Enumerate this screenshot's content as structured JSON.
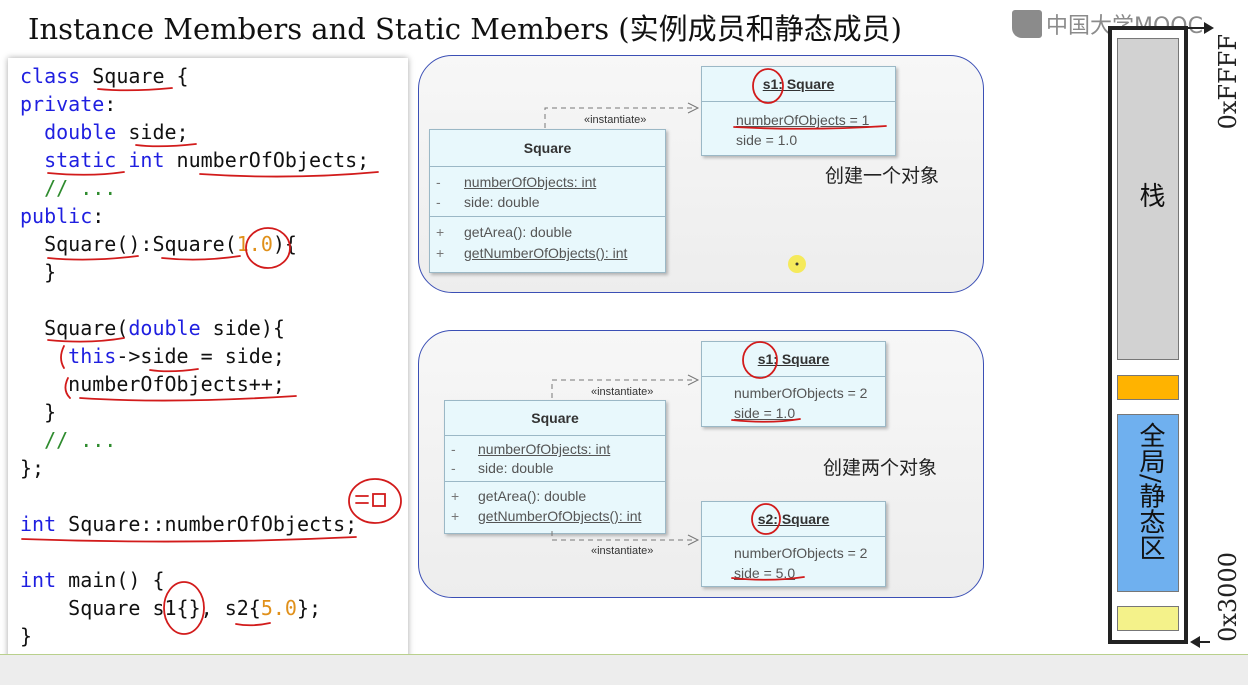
{
  "slide": {
    "title": "Instance Members and Static Members (实例成员和静态成员)"
  },
  "watermark": {
    "text": "中国大学MOOC"
  },
  "code": {
    "l1": [
      "class",
      " ",
      "Square",
      " {"
    ],
    "l2": [
      "private",
      ":"
    ],
    "l3": [
      "  ",
      "double",
      " side;"
    ],
    "l4": [
      "  ",
      "static",
      " ",
      "int",
      " numberOfObjects;"
    ],
    "l5": [
      "  // ..."
    ],
    "l6": [
      "public",
      ":"
    ],
    "l7": [
      "  Square():Square(",
      "1.0",
      "){"
    ],
    "l8": [
      "  }"
    ],
    "l10": [
      "  Square(",
      "double",
      " side){"
    ],
    "l11": [
      "    ",
      "this",
      "->side = side;"
    ],
    "l12": [
      "    numberOfObjects++;"
    ],
    "l13": [
      "  }"
    ],
    "l14": [
      "  // ..."
    ],
    "l15": [
      "};"
    ],
    "l17": [
      "int",
      " Square::numberOfObjects;"
    ],
    "l19": [
      "int",
      " main() {"
    ],
    "l20": [
      "    Square s1{}, s2{",
      "5.0",
      "};"
    ],
    "l21": [
      "}"
    ]
  },
  "diagram1": {
    "class_box": {
      "name": "Square",
      "attrs": [
        {
          "vis": "-",
          "text": "numberOfObjects: int"
        },
        {
          "vis": "-",
          "text": "side: double"
        }
      ],
      "ops": [
        {
          "vis": "+",
          "text": "getArea(): double"
        },
        {
          "vis": "+",
          "text": "getNumberOfObjects(): int"
        }
      ]
    },
    "stereotype": "«instantiate»",
    "object": {
      "name": "s1: Square",
      "rows": [
        "numberOfObjects = 1",
        "side = 1.0"
      ]
    },
    "caption": "创建一个对象"
  },
  "diagram2": {
    "class_box": {
      "name": "Square",
      "attrs": [
        {
          "vis": "-",
          "text": "numberOfObjects: int"
        },
        {
          "vis": "-",
          "text": "side: double"
        }
      ],
      "ops": [
        {
          "vis": "+",
          "text": "getArea(): double"
        },
        {
          "vis": "+",
          "text": "getNumberOfObjects(): int"
        }
      ]
    },
    "stereotype_top": "«instantiate»",
    "stereotype_bottom": "«instantiate»",
    "object1": {
      "name": "s1: Square",
      "rows": [
        "numberOfObjects = 2",
        "side = 1.0"
      ]
    },
    "object2": {
      "name": "s2: Square",
      "rows": [
        "numberOfObjects = 2",
        "side = 5.0"
      ]
    },
    "caption": "创建两个对象"
  },
  "memory": {
    "stack_label": "栈",
    "global_label": "全局/静态区",
    "addr_top": "0xFFFF",
    "addr_bottom": "0x3000",
    "colors": {
      "stack": "#d2d2d2",
      "heap": "#ffb300",
      "global": "#6fb0ef",
      "code": "#f4f28a"
    }
  },
  "annotation": {
    "handwritten": "=0"
  }
}
